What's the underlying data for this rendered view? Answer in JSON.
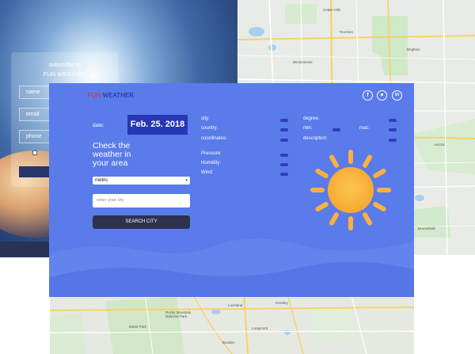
{
  "subscribe": {
    "title_line1": "subscribe to",
    "title_line2": "FUN WEATHER",
    "name_placeholder": "name",
    "email_placeholder": "email",
    "phone_placeholder": "phone"
  },
  "header": {
    "brand_part1": "FUN",
    "brand_part2": " WEATHER",
    "social": [
      {
        "name": "facebook",
        "glyph": "f"
      },
      {
        "name": "github",
        "glyph": "♥"
      },
      {
        "name": "linkedin",
        "glyph": "in"
      }
    ]
  },
  "form": {
    "date_label": "date:",
    "date_value": "Feb. 25. 2018",
    "headline": "Check the weather in your area",
    "units_value": "metric",
    "city_placeholder": "enter your city",
    "search_label": "SEARCH CITY"
  },
  "fields": {
    "city": "city:",
    "country": "country:",
    "coordinates": "coordinates:",
    "pressure": "Pressure:",
    "humidity": "Humidity:",
    "wind": "Wind:",
    "degree": "degree:",
    "min": "min:",
    "max": "mac:",
    "description": "description:"
  },
  "map_labels": {
    "a": "Cedar Hills",
    "b": "Westminster",
    "c": "Thornton",
    "d": "Aurora",
    "e": "Loveland",
    "f": "Greeley",
    "g": "Boulder",
    "h": "Longmont",
    "i": "Rocky Mountain National Park",
    "j": "Broomfield",
    "k": "Brighton",
    "l": "Estes Park"
  },
  "colors": {
    "card": "#5a7bea",
    "date_badge": "#2637b5",
    "button": "#2e3250",
    "sun": "#fbb13f",
    "brand_red": "#e8262a",
    "brand_blue": "#1c2a8a"
  }
}
